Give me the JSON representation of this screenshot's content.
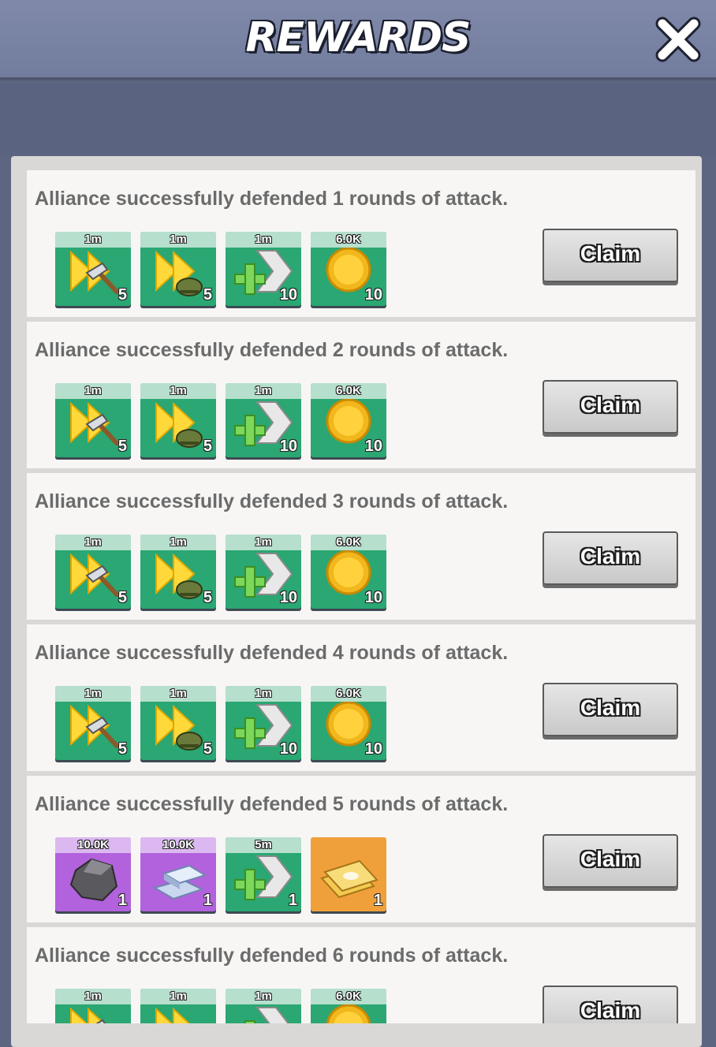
{
  "header": {
    "title": "REWARDS",
    "close_icon": "close-icon"
  },
  "colors": {
    "header": "#7c86a7",
    "green_tile": "#2aa772",
    "purple_tile": "#b262dc",
    "orange_tile": "#f0a03a"
  },
  "rows": [
    {
      "text": "Alliance successfully defended 1 rounds of attack.",
      "claim_label": "Claim",
      "rewards": [
        {
          "icon": "build-speedup-icon",
          "bg": "green",
          "top": "1m",
          "count": "5"
        },
        {
          "icon": "training-speedup-icon",
          "bg": "green",
          "top": "1m",
          "count": "5"
        },
        {
          "icon": "healing-speedup-icon",
          "bg": "green",
          "top": "1m",
          "count": "10"
        },
        {
          "icon": "gold-coin-icon",
          "bg": "green",
          "top": "6.0K",
          "count": "10"
        }
      ]
    },
    {
      "text": "Alliance successfully defended 2 rounds of attack.",
      "claim_label": "Claim",
      "rewards": [
        {
          "icon": "build-speedup-icon",
          "bg": "green",
          "top": "1m",
          "count": "5"
        },
        {
          "icon": "training-speedup-icon",
          "bg": "green",
          "top": "1m",
          "count": "5"
        },
        {
          "icon": "healing-speedup-icon",
          "bg": "green",
          "top": "1m",
          "count": "10"
        },
        {
          "icon": "gold-coin-icon",
          "bg": "green",
          "top": "6.0K",
          "count": "10"
        }
      ]
    },
    {
      "text": "Alliance successfully defended 3 rounds of attack.",
      "claim_label": "Claim",
      "rewards": [
        {
          "icon": "build-speedup-icon",
          "bg": "green",
          "top": "1m",
          "count": "5"
        },
        {
          "icon": "training-speedup-icon",
          "bg": "green",
          "top": "1m",
          "count": "5"
        },
        {
          "icon": "healing-speedup-icon",
          "bg": "green",
          "top": "1m",
          "count": "10"
        },
        {
          "icon": "gold-coin-icon",
          "bg": "green",
          "top": "6.0K",
          "count": "10"
        }
      ]
    },
    {
      "text": "Alliance successfully defended 4 rounds of attack.",
      "claim_label": "Claim",
      "rewards": [
        {
          "icon": "build-speedup-icon",
          "bg": "green",
          "top": "1m",
          "count": "5"
        },
        {
          "icon": "training-speedup-icon",
          "bg": "green",
          "top": "1m",
          "count": "5"
        },
        {
          "icon": "healing-speedup-icon",
          "bg": "green",
          "top": "1m",
          "count": "10"
        },
        {
          "icon": "gold-coin-icon",
          "bg": "green",
          "top": "6.0K",
          "count": "10"
        }
      ]
    },
    {
      "text": "Alliance successfully defended 5 rounds of attack.",
      "claim_label": "Claim",
      "rewards": [
        {
          "icon": "stone-icon",
          "bg": "purple",
          "top": "10.0K",
          "count": "1"
        },
        {
          "icon": "iron-ingot-icon",
          "bg": "purple",
          "top": "10.0K",
          "count": "1"
        },
        {
          "icon": "healing-speedup-icon",
          "bg": "green",
          "top": "5m",
          "count": "1"
        },
        {
          "icon": "gold-card-icon",
          "bg": "orange",
          "top": "",
          "count": "1"
        }
      ]
    },
    {
      "text": "Alliance successfully defended 6 rounds of attack.",
      "claim_label": "Claim",
      "rewards": [
        {
          "icon": "build-speedup-icon",
          "bg": "green",
          "top": "1m",
          "count": ""
        },
        {
          "icon": "training-speedup-icon",
          "bg": "green",
          "top": "1m",
          "count": ""
        },
        {
          "icon": "healing-speedup-icon",
          "bg": "green",
          "top": "1m",
          "count": ""
        },
        {
          "icon": "gold-coin-icon",
          "bg": "green",
          "top": "6.0K",
          "count": ""
        }
      ]
    }
  ]
}
